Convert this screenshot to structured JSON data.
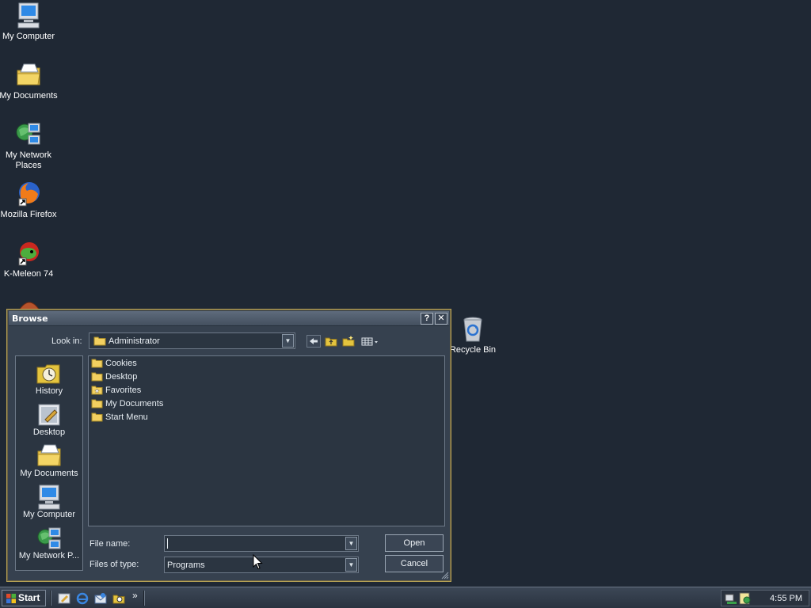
{
  "desktop": {
    "icons": [
      {
        "label": "My Computer",
        "icon": "computer-icon"
      },
      {
        "label": "My Documents",
        "icon": "documents-folder-icon"
      },
      {
        "label": "My Network Places",
        "icon": "network-places-icon"
      },
      {
        "label": "Mozilla Firefox",
        "icon": "firefox-icon"
      },
      {
        "label": "K-Meleon 74",
        "icon": "kmeleon-icon"
      },
      {
        "label": "Recycle Bin",
        "icon": "recycle-bin-icon"
      }
    ]
  },
  "dialog": {
    "title": "Browse",
    "help_button": "?",
    "close_button": "✕",
    "look_in_label": "Look in:",
    "look_in_value": "Administrator",
    "places": [
      {
        "label": "History",
        "icon": "history-icon"
      },
      {
        "label": "Desktop",
        "icon": "desktop-icon"
      },
      {
        "label": "My Documents",
        "icon": "documents-folder-icon"
      },
      {
        "label": "My Computer",
        "icon": "computer-icon"
      },
      {
        "label": "My Network P...",
        "icon": "network-places-icon"
      }
    ],
    "files": [
      {
        "name": "Cookies",
        "icon": "folder-icon"
      },
      {
        "name": "Desktop",
        "icon": "folder-icon"
      },
      {
        "name": "Favorites",
        "icon": "favorites-folder-icon"
      },
      {
        "name": "My Documents",
        "icon": "folder-icon"
      },
      {
        "name": "Start Menu",
        "icon": "folder-icon"
      }
    ],
    "file_name_label": "File name:",
    "file_name_value": "",
    "files_of_type_label": "Files of type:",
    "files_of_type_value": "Programs",
    "open_button": "Open",
    "cancel_button": "Cancel"
  },
  "taskbar": {
    "start_label": "Start",
    "clock": "4:55 PM",
    "quick_launch_more": "»"
  }
}
